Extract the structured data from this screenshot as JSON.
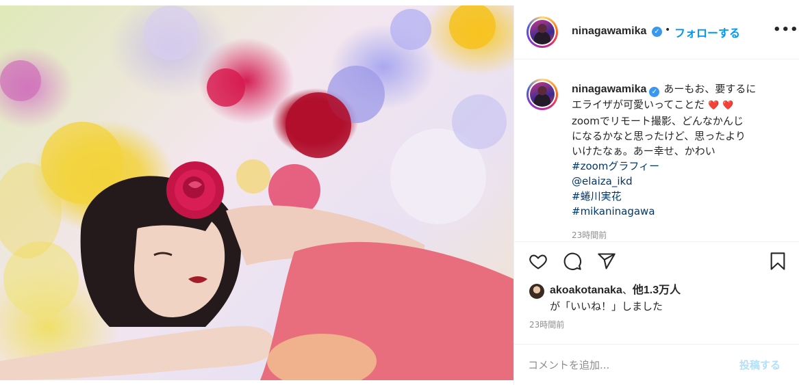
{
  "header": {
    "username": "ninagawamika",
    "follow_label": "フォローする",
    "separator": "•",
    "more": "•••"
  },
  "caption": {
    "username": "ninagawamika",
    "line1": "あーもお、要するに",
    "line2": "エライザが可愛いってことだ",
    "line3": "zoomでリモート撮影、どんなかんじ",
    "line4": "になるかなと思ったけど、思ったより",
    "line5": "いけたなぁ。あー幸せ、かわい",
    "tags": [
      "#zoomグラフィー",
      "@elaiza_ikd",
      "#蜷川実花",
      "#mikaninagawa"
    ],
    "time": "23時間前"
  },
  "likes": {
    "liker": "akoakotanaka",
    "sep": "、",
    "others": "他1.3万人",
    "liked_text": "が「いいね！」しました"
  },
  "post_time": "23時間前",
  "comment": {
    "placeholder": "コメントを追加...",
    "post_label": "投稿する"
  },
  "icons": {
    "verified": "verified-badge-icon",
    "like": "heart-icon",
    "comment": "comment-icon",
    "share": "paper-plane-icon",
    "save": "bookmark-icon"
  },
  "colors": {
    "link": "#0095f6",
    "hashtag": "#00376b",
    "verified": "#3897f0",
    "muted": "#8e8e8e",
    "post_disabled": "#b2dffc"
  }
}
